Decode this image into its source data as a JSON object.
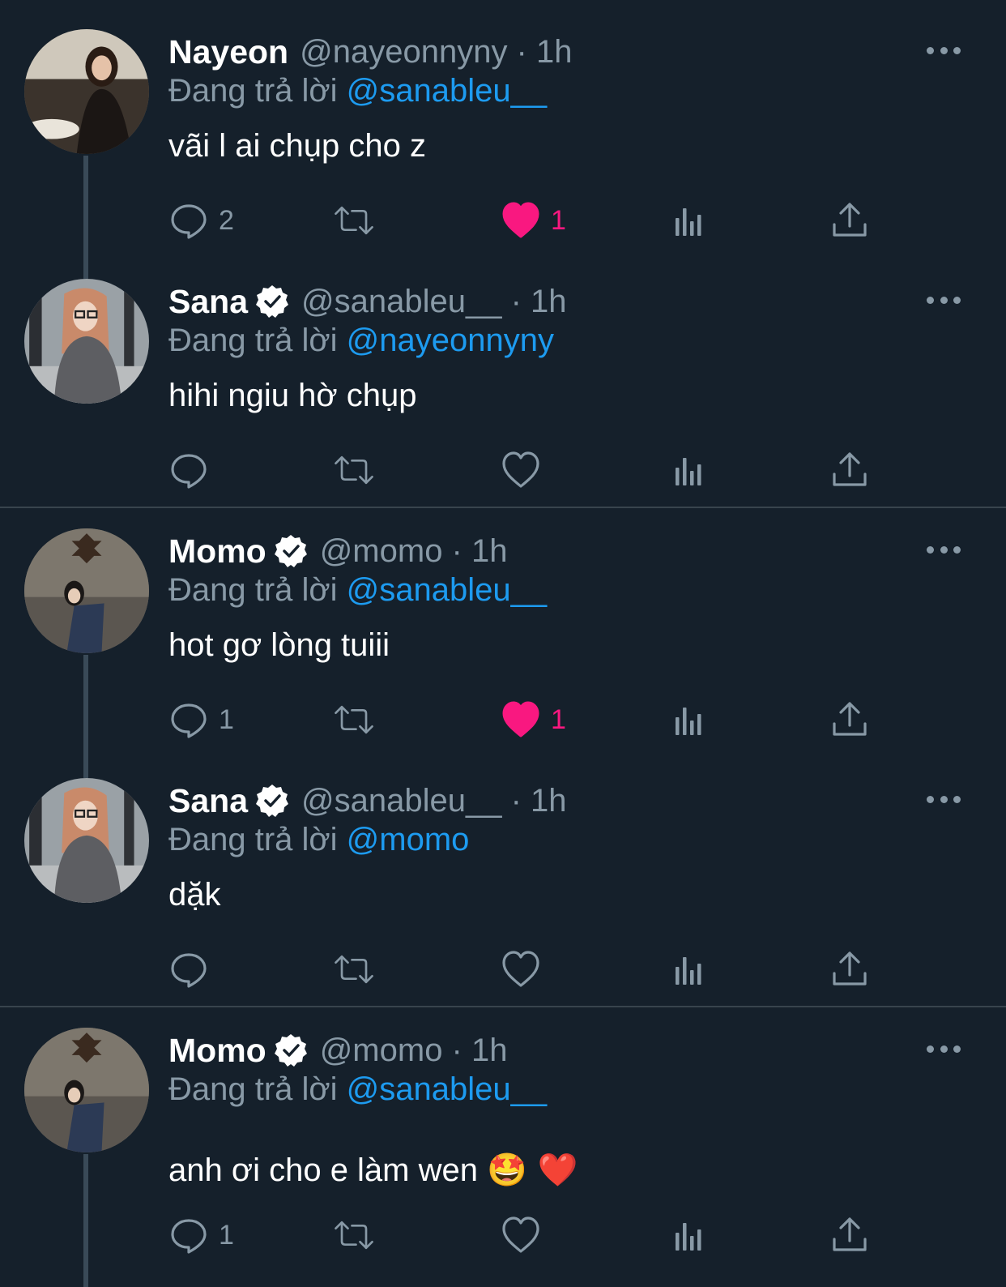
{
  "reply_prefix": "Đang trả lời",
  "tweets": [
    {
      "name": "Nayeon",
      "verified": false,
      "handle": "@nayeonnyny · 1h",
      "reply_to": "@sanableu__",
      "text": "vãi l ai chụp cho z",
      "reply_count": "2",
      "like_count": "1",
      "liked": true,
      "avatar": "nayeon-photo"
    },
    {
      "name": "Sana",
      "verified": true,
      "handle": "@sanableu__ · 1h",
      "reply_to": "@nayeonnyny",
      "text": "hihi ngiu hờ chụp",
      "reply_count": "",
      "like_count": "",
      "liked": false,
      "avatar": "sana-photo"
    },
    {
      "name": "Momo",
      "verified": true,
      "handle": "@momo · 1h",
      "reply_to": "@sanableu__",
      "text": "hot gơ lòng tuiii",
      "reply_count": "1",
      "like_count": "1",
      "liked": true,
      "avatar": "momo-photo"
    },
    {
      "name": "Sana",
      "verified": true,
      "handle": "@sanableu__ · 1h",
      "reply_to": "@momo",
      "text": "dặk",
      "reply_count": "",
      "like_count": "",
      "liked": false,
      "avatar": "sana-photo"
    },
    {
      "name": "Momo",
      "verified": true,
      "handle": "@momo · 1h",
      "reply_to": "@sanableu__",
      "text": "anh ơi cho e làm wen",
      "emojis": "🤩 ❤️",
      "reply_count": "1",
      "like_count": "",
      "liked": false,
      "avatar": "momo-photo"
    }
  ],
  "icons": [
    "reply-icon",
    "retweet-icon",
    "like-icon",
    "views-icon",
    "share-icon",
    "more-icon",
    "verified-badge-icon"
  ],
  "colors": {
    "background": "#15202b",
    "secondary_text": "#8899a6",
    "mention": "#1d9bf0",
    "like": "#f91880",
    "separator": "#38444d"
  }
}
